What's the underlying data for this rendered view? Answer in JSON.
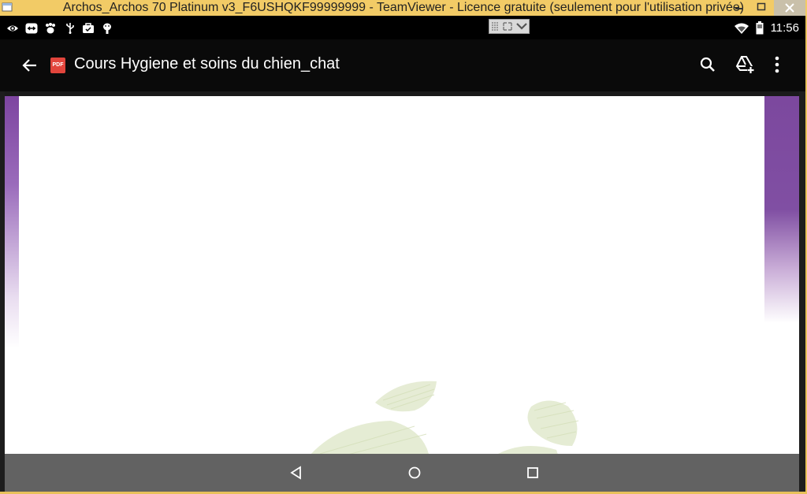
{
  "window": {
    "title": "Archos_Archos 70 Platinum v3_F6USHQKF99999999 - TeamViewer - Licence gratuite (seulement pour l'utilisation privée)"
  },
  "statusbar": {
    "time": "11:56",
    "left_icons": [
      "eye-icon",
      "teamviewer-icon",
      "paw-icon",
      "usb-icon",
      "briefcase-icon",
      "android-icon"
    ],
    "right_icons": [
      "wifi-icon",
      "battery-icon"
    ]
  },
  "toolbar": {
    "back_icon": "arrow-left-icon",
    "file_badge": "PDF",
    "document_title": "Cours Hygiene et soins du chien_chat",
    "actions": [
      "search-icon",
      "drive-add-icon",
      "more-vert-icon"
    ]
  },
  "navigation": {
    "buttons": [
      "back-triangle-icon",
      "home-circle-icon",
      "recents-square-icon"
    ]
  },
  "colors": {
    "accent_purple": "#7d45a0",
    "pdf_red": "#e2453c",
    "window_titlebar": "#f2cb66"
  }
}
